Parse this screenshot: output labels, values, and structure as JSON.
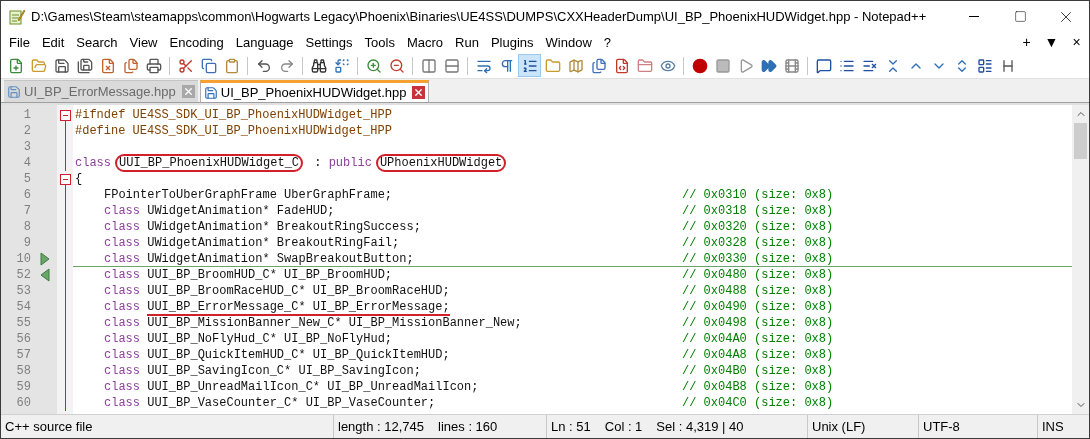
{
  "window": {
    "title": "D:\\Games\\Steam\\steamapps\\common\\Hogwarts Legacy\\Phoenix\\Binaries\\UE4SS\\DUMPS\\CXXHeaderDump\\UI_BP_PhoenixHUDWidget.hpp - Notepad++"
  },
  "menu": [
    "File",
    "Edit",
    "Search",
    "View",
    "Encoding",
    "Language",
    "Settings",
    "Tools",
    "Macro",
    "Run",
    "Plugins",
    "Window",
    "?"
  ],
  "menu_right": [
    "+",
    "▼",
    "×"
  ],
  "toolbar": [
    [
      {
        "selected": false
      },
      {
        "selected": false
      },
      {
        "selected": false
      },
      {
        "selected": false
      },
      {
        "selected": false
      },
      {
        "selected": false
      },
      {
        "selected": false
      }
    ],
    [
      {
        "selected": false
      },
      {
        "selected": false
      },
      {
        "selected": false
      }
    ],
    [
      {
        "selected": false
      },
      {
        "selected": false
      }
    ],
    [
      {
        "selected": false
      },
      {
        "selected": false
      }
    ],
    [
      {
        "selected": false
      },
      {
        "selected": false
      }
    ],
    [
      {
        "selected": false
      },
      {
        "selected": false
      }
    ],
    [
      {
        "selected": false
      },
      {
        "selected": false
      },
      {
        "selected": true
      },
      {
        "selected": false
      },
      {
        "selected": false
      },
      {
        "selected": false
      },
      {
        "selected": false
      },
      {
        "selected": false
      },
      {
        "selected": false
      }
    ],
    [
      {
        "selected": false
      },
      {
        "selected": false
      },
      {
        "selected": false
      },
      {
        "selected": false
      },
      {
        "selected": false
      }
    ],
    [
      {
        "selected": false
      },
      {
        "selected": false
      },
      {
        "selected": false
      },
      {
        "selected": false
      },
      {
        "selected": false
      },
      {
        "selected": false
      },
      {
        "selected": false
      },
      {
        "selected": false
      },
      {
        "selected": false
      }
    ]
  ],
  "tabs": [
    {
      "label": "UI_BP_ErrorMessage.hpp",
      "selected": false
    },
    {
      "label": "UI_BP_PhoenixHUDWidget.hpp",
      "selected": true
    }
  ],
  "lines": [
    {
      "number": "1",
      "fold_start": true,
      "hidden_start": false,
      "hidden_end": false,
      "indented": false,
      "parts": [
        {
          "kind": "preprocessor",
          "text": "#ifndef UE4SS_SDK_UI_BP_PhoenixHUDWidget_HPP"
        }
      ]
    },
    {
      "number": "2",
      "fold_start": false,
      "hidden_start": false,
      "hidden_end": false,
      "indented": false,
      "parts": [
        {
          "kind": "preprocessor",
          "text": "#define UE4SS_SDK_UI_BP_PhoenixHUDWidget_HPP"
        }
      ]
    },
    {
      "number": "3",
      "fold_start": false,
      "hidden_start": false,
      "hidden_end": false,
      "indented": false
    },
    {
      "number": "4",
      "fold_start": false,
      "hidden_start": false,
      "hidden_end": false,
      "indented": false,
      "parts": [
        {
          "kind": "keyword",
          "text": "class"
        },
        {
          "kind": "circled",
          "text": "UUI_BP_PhoenixHUDWidget_C"
        },
        {
          "kind": "plain",
          "text": " : "
        },
        {
          "kind": "keyword",
          "text": "public"
        },
        {
          "kind": "circled",
          "text": "UPhoenixHUDWidget"
        }
      ]
    },
    {
      "number": "5",
      "fold_start": true,
      "hidden_start": false,
      "hidden_end": false,
      "indented": false,
      "parts": [
        {
          "kind": "plain",
          "text": "{"
        }
      ]
    },
    {
      "number": "6",
      "fold_start": false,
      "hidden_start": false,
      "hidden_end": false,
      "indented": true,
      "parts": [
        {
          "kind": "plain",
          "text": "FPointerToUberGraphFrame UberGraphFrame;"
        }
      ],
      "comment": "// 0x0310 (size: 0x8)"
    },
    {
      "number": "7",
      "fold_start": false,
      "hidden_start": false,
      "hidden_end": false,
      "indented": true,
      "parts": [
        {
          "kind": "keyword",
          "text": "class "
        },
        {
          "kind": "plain",
          "text": "UWidgetAnimation* FadeHUD;"
        }
      ],
      "comment": "// 0x0318 (size: 0x8)"
    },
    {
      "number": "8",
      "fold_start": false,
      "hidden_start": false,
      "hidden_end": false,
      "indented": true,
      "parts": [
        {
          "kind": "keyword",
          "text": "class "
        },
        {
          "kind": "plain",
          "text": "UWidgetAnimation* BreakoutRingSuccess;"
        }
      ],
      "comment": "// 0x0320 (size: 0x8)"
    },
    {
      "number": "9",
      "fold_start": false,
      "hidden_start": false,
      "hidden_end": false,
      "indented": true,
      "parts": [
        {
          "kind": "keyword",
          "text": "class "
        },
        {
          "kind": "plain",
          "text": "UWidgetAnimation* BreakoutRingFail;"
        }
      ],
      "comment": "// 0x0328 (size: 0x8)"
    },
    {
      "number": "10",
      "fold_start": false,
      "hidden_start": true,
      "hidden_end": false,
      "indented": true,
      "parts": [
        {
          "kind": "keyword",
          "text": "class "
        },
        {
          "kind": "plain",
          "text": "UWidgetAnimation* SwapBreakoutButton;"
        }
      ],
      "comment": "// 0x0330 (size: 0x8)"
    },
    {
      "number": "52",
      "fold_start": false,
      "hidden_start": false,
      "hidden_end": true,
      "indented": true,
      "parts": [
        {
          "kind": "keyword",
          "text": "class "
        },
        {
          "kind": "plain",
          "text": "UUI_BP_BroomHUD_C* UI_BP_BroomHUD;"
        }
      ],
      "comment": "// 0x0480 (size: 0x8)"
    },
    {
      "number": "53",
      "fold_start": false,
      "hidden_start": false,
      "hidden_end": false,
      "indented": true,
      "parts": [
        {
          "kind": "keyword",
          "text": "class "
        },
        {
          "kind": "plain",
          "text": "UUI_BP_BroomRaceHUD_C* UI_BP_BroomRaceHUD;"
        }
      ],
      "comment": "// 0x0488 (size: 0x8)"
    },
    {
      "number": "54",
      "fold_start": false,
      "hidden_start": false,
      "hidden_end": false,
      "indented": true,
      "parts": [
        {
          "kind": "keyword",
          "text": "class "
        },
        {
          "kind": "underlined",
          "text": "UUI_BP_ErrorMessage_C* UI_BP_ErrorMessage;"
        }
      ],
      "comment": "// 0x0490 (size: 0x8)"
    },
    {
      "number": "55",
      "fold_start": false,
      "hidden_start": false,
      "hidden_end": false,
      "indented": true,
      "parts": [
        {
          "kind": "keyword",
          "text": "class "
        },
        {
          "kind": "plain",
          "text": "UUI_BP_MissionBanner_New_C* UI_BP_MissionBanner_New;"
        }
      ],
      "comment": "// 0x0498 (size: 0x8)"
    },
    {
      "number": "56",
      "fold_start": false,
      "hidden_start": false,
      "hidden_end": false,
      "indented": true,
      "parts": [
        {
          "kind": "keyword",
          "text": "class "
        },
        {
          "kind": "plain",
          "text": "UUI_BP_NoFlyHud_C* UI_BP_NoFlyHud;"
        }
      ],
      "comment": "// 0x04A0 (size: 0x8)"
    },
    {
      "number": "57",
      "fold_start": false,
      "hidden_start": false,
      "hidden_end": false,
      "indented": true,
      "parts": [
        {
          "kind": "keyword",
          "text": "class "
        },
        {
          "kind": "plain",
          "text": "UUI_BP_QuickItemHUD_C* UI_BP_QuickItemHUD;"
        }
      ],
      "comment": "// 0x04A8 (size: 0x8)"
    },
    {
      "number": "58",
      "fold_start": false,
      "hidden_start": false,
      "hidden_end": false,
      "indented": true,
      "parts": [
        {
          "kind": "keyword",
          "text": "class "
        },
        {
          "kind": "plain",
          "text": "UUI_BP_SavingIcon_C* UI_BP_SavingIcon;"
        }
      ],
      "comment": "// 0x04B0 (size: 0x8)"
    },
    {
      "number": "59",
      "fold_start": false,
      "hidden_start": false,
      "hidden_end": false,
      "indented": true,
      "parts": [
        {
          "kind": "keyword",
          "text": "class "
        },
        {
          "kind": "plain",
          "text": "UUI_BP_UnreadMailIcon_C* UI_BP_UnreadMailIcon;"
        }
      ],
      "comment": "// 0x04B8 (size: 0x8)"
    },
    {
      "number": "60",
      "fold_start": false,
      "hidden_start": false,
      "hidden_end": false,
      "indented": true,
      "parts": [
        {
          "kind": "keyword",
          "text": "class "
        },
        {
          "kind": "plain",
          "text": "UUI_BP_VaseCounter_C* UI_BP_VaseCounter;"
        }
      ],
      "comment": "// 0x04C0 (size: 0x8)"
    }
  ],
  "status_bar": {
    "file_type": "C++ source file",
    "length": "length : 12,745",
    "lines": "lines : 160",
    "line": "Ln : 51",
    "column": "Col : 1",
    "selection": "Sel : 4,319 | 40",
    "eol": "Unix (LF)",
    "encoding": "UTF-8",
    "mode": "INS"
  }
}
